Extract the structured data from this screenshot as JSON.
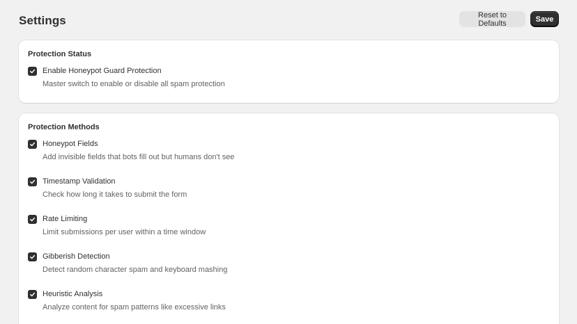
{
  "header": {
    "title": "Settings",
    "reset_label": "Reset to Defaults",
    "save_label": "Save"
  },
  "protection_status": {
    "title": "Protection Status",
    "items": [
      {
        "label": "Enable Honeypot Guard Protection",
        "description": "Master switch to enable or disable all spam protection",
        "checked": true
      }
    ]
  },
  "protection_methods": {
    "title": "Protection Methods",
    "items": [
      {
        "label": "Honeypot Fields",
        "description": "Add invisible fields that bots fill out but humans don't see",
        "checked": true
      },
      {
        "label": "Timestamp Validation",
        "description": "Check how long it takes to submit the form",
        "checked": true
      },
      {
        "label": "Rate Limiting",
        "description": "Limit submissions per user within a time window",
        "checked": true
      },
      {
        "label": "Gibberish Detection",
        "description": "Detect random character spam and keyboard mashing",
        "checked": true
      },
      {
        "label": "Heuristic Analysis",
        "description": "Analyze content for spam patterns like excessive links",
        "checked": true
      }
    ]
  },
  "icons": {
    "checkbox": "checkmark-icon"
  },
  "colors": {
    "primary": "#303030",
    "background": "#f1f1f1",
    "card": "#ffffff",
    "muted_text": "#616161"
  }
}
